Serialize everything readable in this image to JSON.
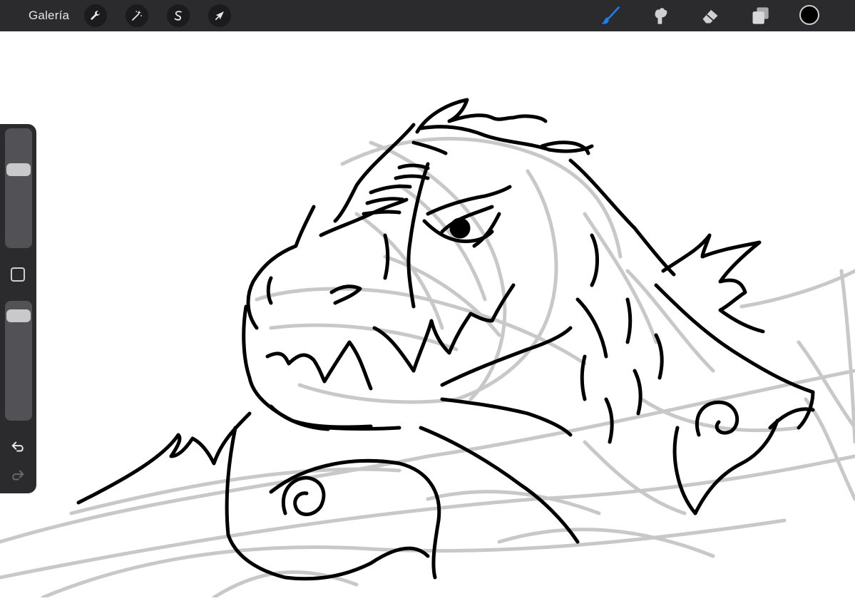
{
  "topbar": {
    "gallery_label": "Galería",
    "left_tools": [
      {
        "icon": "wrench-icon",
        "name": "actions"
      },
      {
        "icon": "magic-wand-icon",
        "name": "adjustments"
      },
      {
        "icon": "selection-s-icon",
        "name": "selection"
      },
      {
        "icon": "arrow-cursor-icon",
        "name": "transform"
      }
    ],
    "right_tools": [
      {
        "icon": "brush-icon",
        "name": "paint",
        "active": true
      },
      {
        "icon": "smudge-icon",
        "name": "smudge"
      },
      {
        "icon": "eraser-icon",
        "name": "eraser"
      },
      {
        "icon": "layers-icon",
        "name": "layers"
      }
    ],
    "current_color": "#000000"
  },
  "sidebar": {
    "brush_size_level": 0.68,
    "opacity_level": 0.93
  },
  "colors": {
    "bar_background": "#2b2b2d",
    "active_tool": "#1a7ff0",
    "sketch_gray": "#c8c8c8",
    "ink_black": "#000000"
  }
}
